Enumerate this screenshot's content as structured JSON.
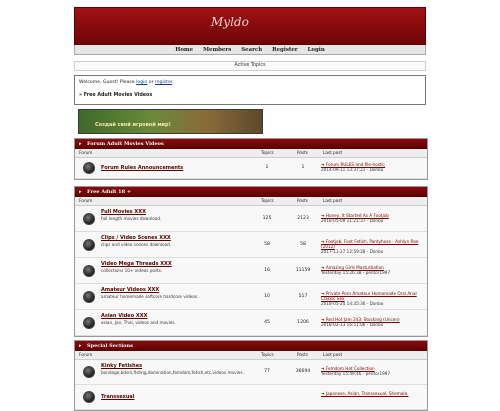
{
  "logo": "Myldo",
  "nav": [
    "Home",
    "Members",
    "Search",
    "Register",
    "Login"
  ],
  "active_topics": "Active Topics",
  "welcome": {
    "prefix": "Welcome, Guest!   Please",
    "login": "login",
    "or": "or",
    "register": "register",
    "free_link": "» Free Adult Movies Videos"
  },
  "banner_text": "Создай свой игровой мир!",
  "columns": {
    "forum": "Forum",
    "topics": "Topics",
    "posts": "Posts",
    "last_post": "Last post"
  },
  "sections": [
    {
      "title": "Forum Adult Movies Videos",
      "rows": [
        {
          "title": "Forum Rules Announcements",
          "desc": "",
          "topics": "1",
          "posts": "1",
          "last_title": "Forum RULES and file-hosts;",
          "last_meta": "2014-09-11 13:37:21 - Donbo"
        }
      ]
    },
    {
      "title": "Free Adult 18 +",
      "rows": [
        {
          "title": "Full Movies XXX",
          "desc": "full length movies download.",
          "topics": "125",
          "posts": "2123",
          "last_title": "Honey, It Started As A Footjob",
          "last_meta": "2018-05-09 11:21:37 - Donbo"
        },
        {
          "title": "Clips / Video Scenes XXX",
          "desc": "clips and video scenes download.",
          "topics": "58",
          "posts": "58",
          "last_title": "Footjob, Foot Fetish, Pantyhose - Ashlyn Rae (2012)",
          "last_meta": "2017-11-27 12:59:28 - Donbo"
        },
        {
          "title": "Video Mega Threads XXX",
          "desc": "collections 10+ videos posts.",
          "topics": "16",
          "posts": "11159",
          "last_title": "Amazing Girls Masturbation",
          "last_meta": "Yesterday 15:26:38 - pentor1997"
        },
        {
          "title": "Amateur Videos XXX",
          "desc": "amateur homemade softcore hardcore videos.",
          "topics": "10",
          "posts": "517",
          "last_title": "Private Porn Amateur Homemade Oral Anal Classic Sex",
          "last_meta": "2018-05-24 14:35:36 - Donbo"
        },
        {
          "title": "Asian Video XXX",
          "desc": "asian, Jav, Thai, videos and movies.",
          "topics": "45",
          "posts": "1206",
          "last_title": "Red Hot Jam 243: Stocking (Uncen)",
          "last_meta": "2018-02-13 16:51:06 - Donbo"
        }
      ]
    },
    {
      "title": "Special Sections",
      "rows": [
        {
          "title": "Kinky Fetishes",
          "desc": "bondage,bdsm,fisting,domination,femdom,fetish,etc,videos movies.",
          "topics": "77",
          "posts": "36694",
          "last_title": "Femdom Hot Collection",
          "last_meta": "Yesterday 15:49:46 - pentor1997"
        },
        {
          "title": "Transsexual",
          "desc": "",
          "topics": "",
          "posts": "",
          "last_title": "Japanese, Asian, Transsexual, Shemale,",
          "last_meta": ""
        }
      ]
    }
  ]
}
